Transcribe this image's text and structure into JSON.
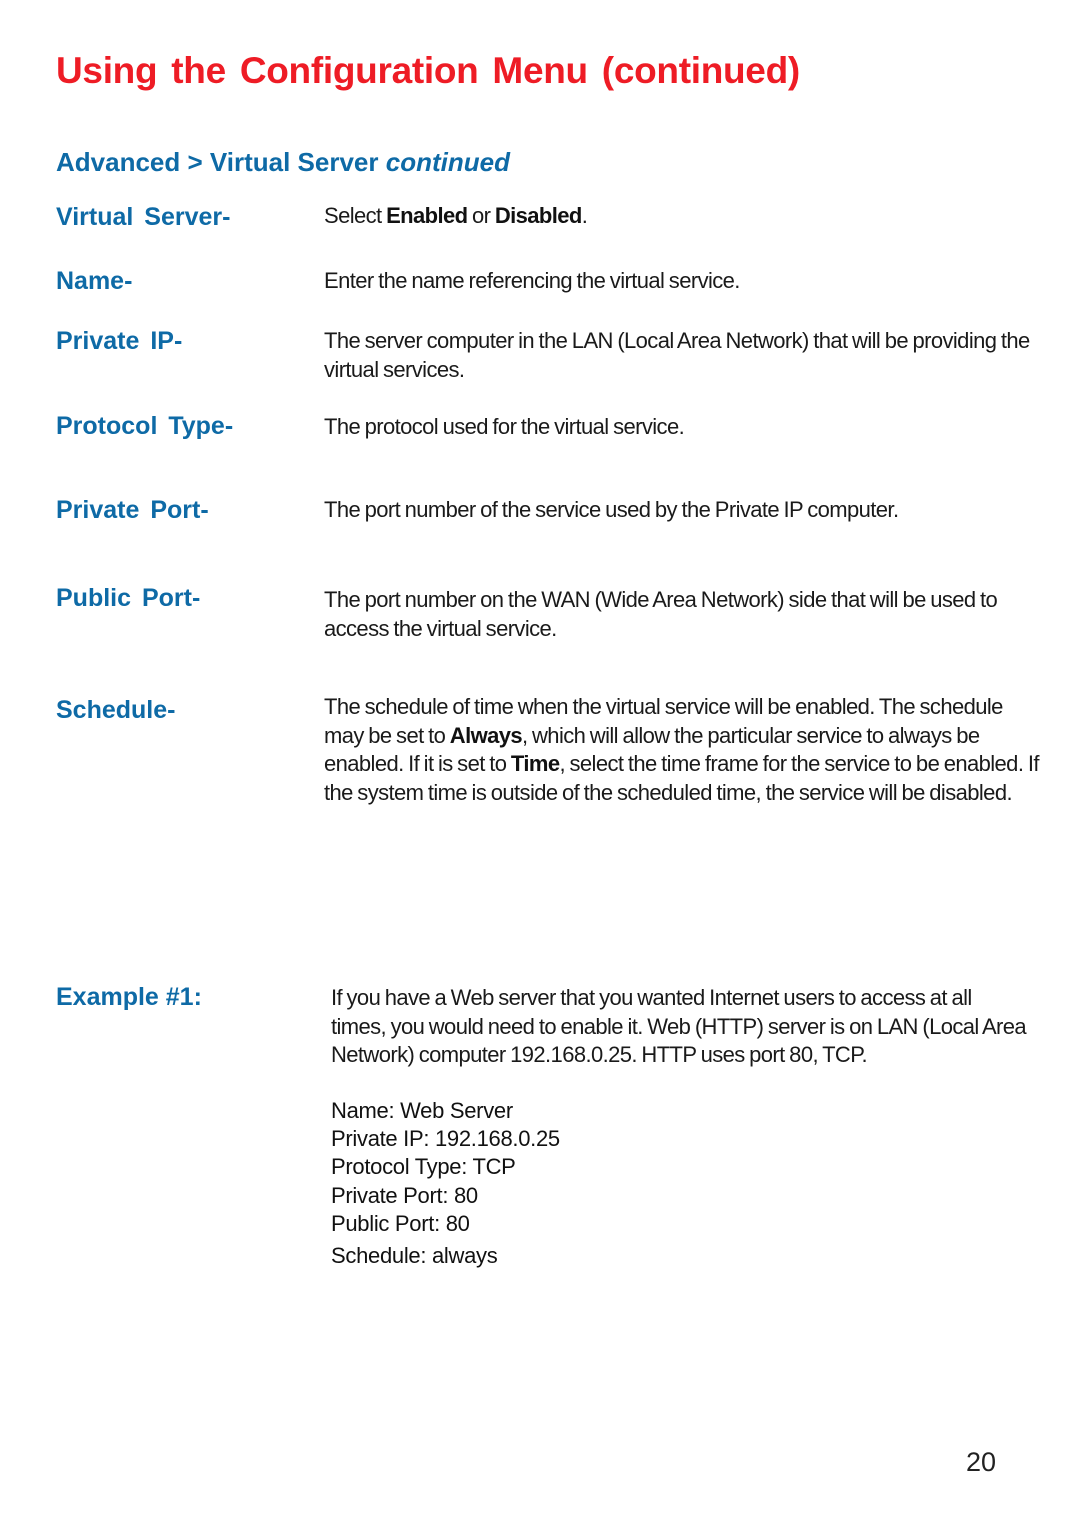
{
  "page": {
    "title": "Using the Configuration Menu (continued)",
    "subheading": {
      "main": "Advanced > Virtual Server ",
      "italic": "continued"
    },
    "page_number": "20"
  },
  "colors": {
    "title": "#ee1c25",
    "heading": "#0e6aa6",
    "body": "#1a1a1a"
  },
  "definitions": [
    {
      "term": "Virtual Server-",
      "desc_parts": [
        {
          "text": "Select ",
          "bold": false
        },
        {
          "text": "Enabled",
          "bold": true
        },
        {
          "text": " or ",
          "bold": false
        },
        {
          "text": "Disabled",
          "bold": true
        },
        {
          "text": ".",
          "bold": false
        }
      ]
    },
    {
      "term": "Name-",
      "desc_parts": [
        {
          "text": "Enter the name referencing the virtual service.",
          "bold": false
        }
      ]
    },
    {
      "term": "Private IP-",
      "desc_parts": [
        {
          "text": "The server computer in the LAN (Local Area Network) that will be providing the virtual services.",
          "bold": false
        }
      ]
    },
    {
      "term": "Protocol Type-",
      "desc_parts": [
        {
          "text": "The protocol used for the virtual service.",
          "bold": false
        }
      ]
    },
    {
      "term": "Private Port-",
      "desc_parts": [
        {
          "text": "The port number of the service used by the Private IP computer.",
          "bold": false
        }
      ]
    },
    {
      "term": "Public Port-",
      "desc_parts": [
        {
          "text": "The port number on the WAN (Wide Area Network) side that will be used to access the virtual service.",
          "bold": false
        }
      ]
    },
    {
      "term": "Schedule-",
      "desc_parts": [
        {
          "text": "The schedule of time when the virtual service will be enabled. The schedule may be set to ",
          "bold": false
        },
        {
          "text": "Always",
          "bold": true
        },
        {
          "text": ", which will allow the particular service to always be enabled. If it is set to ",
          "bold": false
        },
        {
          "text": "Time",
          "bold": true
        },
        {
          "text": ", select the time frame for the service to be enabled. If the system time is outside of the scheduled time, the service will be disabled.",
          "bold": false
        }
      ]
    }
  ],
  "example": {
    "label": "Example #1:",
    "paragraph": "If you have a Web server that you wanted Internet users to access at all times, you would need to enable it. Web (HTTP) server is on LAN (Local Area Network) computer 192.168.0.25. HTTP uses port 80, TCP.",
    "lines": [
      "Name: Web Server",
      "Private IP: 192.168.0.25",
      "Protocol Type: TCP",
      "Private Port: 80",
      "Public Port: 80",
      "Schedule: always"
    ]
  }
}
